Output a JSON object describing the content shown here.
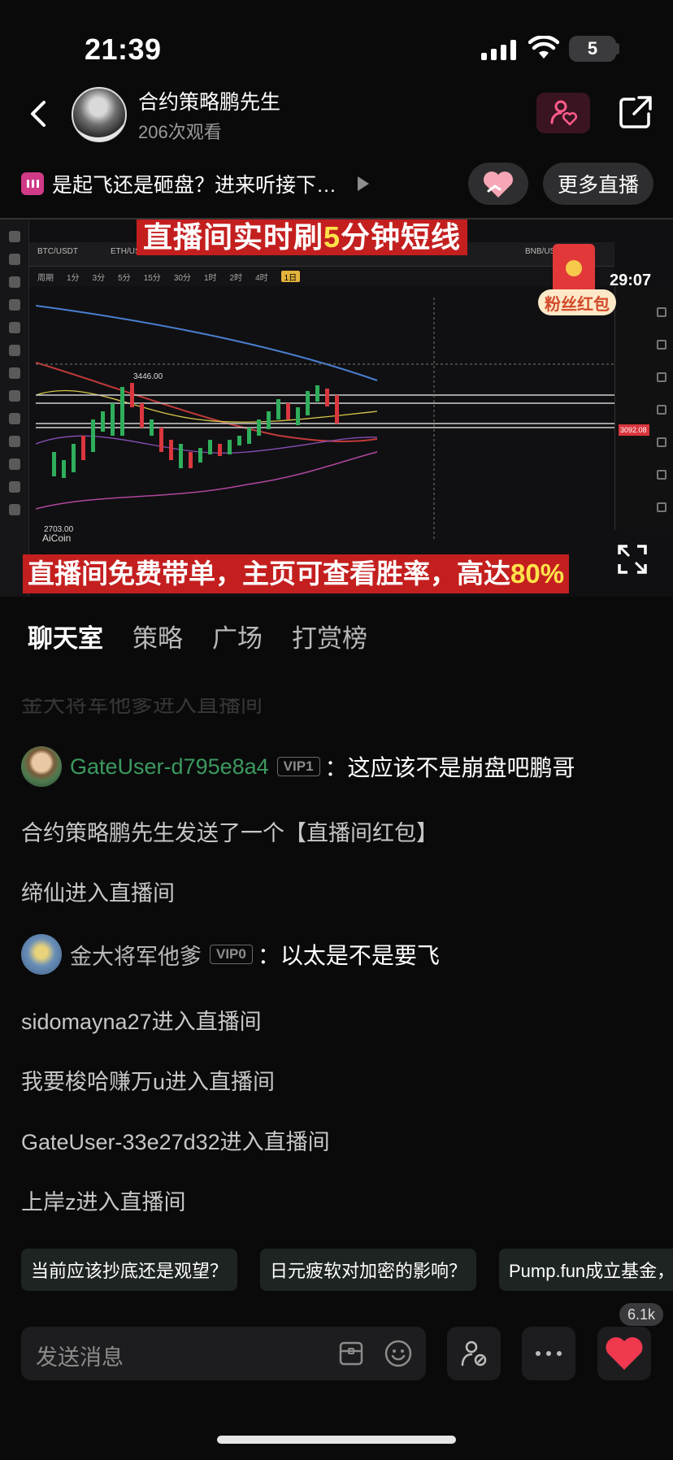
{
  "status_bar": {
    "time": "21:39",
    "battery": "5"
  },
  "header": {
    "host_name": "合约策略鹏先生",
    "views": "206次观看"
  },
  "topic": {
    "text": "是起飞还是砸盘？进来听接下…",
    "more_live": "更多直播"
  },
  "video": {
    "banner_top_pre": "直播间实时刷",
    "banner_top_hl": "5",
    "banner_top_post": "分钟短线",
    "banner_bottom_pre": "直播间免费带单，主页可查看胜率，高达",
    "banner_bottom_hl": "80%",
    "fans_red_packet": "粉丝红包",
    "countdown": "29:07",
    "chart_tabs": [
      "BTC/USDT",
      "ETH/USDT",
      "BNB/USDT"
    ],
    "chart_timeframes": [
      "周期",
      "1分",
      "3分",
      "5分",
      "15分",
      "30分",
      "1时",
      "2时",
      "4时",
      "1日"
    ],
    "chart_high_label": "3446.00",
    "chart_low_label": "2703.00",
    "price_tag": "3092.08",
    "watermark": "AiCoin"
  },
  "tabs": [
    "聊天室",
    "策略",
    "广场",
    "打赏榜"
  ],
  "chat": {
    "faded": "金大将军他爹进入直播间",
    "msg1": {
      "user": "GateUser-d795e8a4",
      "vip": "VIP1",
      "text": "：这应该不是崩盘吧鹏哥"
    },
    "sys1": "合约策略鹏先生发送了一个【直播间红包】",
    "sys2": "缔仙进入直播间",
    "msg2": {
      "user": "金大将军他爹",
      "vip": "VIP0",
      "text": "：以太是不是要飞"
    },
    "sys3": "sidomayna27进入直播间",
    "sys4": "我要梭哈赚万u进入直播间",
    "sys5": "GateUser-33e27d32进入直播间",
    "sys6": "上岸z进入直播间"
  },
  "suggestions": [
    "当前应该抄底还是观望？",
    "日元疲软对加密的影响？",
    "Pump.fun成立基金，"
  ],
  "input": {
    "placeholder": "发送消息"
  },
  "likes": "6.1k",
  "colors": {
    "accent_red": "#c41f1f",
    "highlight_yellow": "#ffe34a",
    "green_name": "#3c9a5f"
  }
}
